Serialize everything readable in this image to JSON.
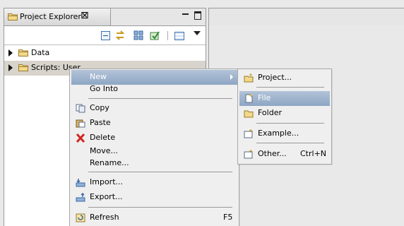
{
  "explorer": {
    "tab_title": "Project Explorer",
    "close_glyph": "⊠",
    "tree": [
      {
        "label": "Data",
        "icon": "folder-icon"
      },
      {
        "label": "Scripts: User",
        "icon": "folder-icon"
      }
    ]
  },
  "context_menu": {
    "items": {
      "new": {
        "label": "New"
      },
      "go_into": {
        "label": "Go Into"
      },
      "copy": {
        "label": "Copy",
        "icon": "copy-icon"
      },
      "paste": {
        "label": "Paste",
        "icon": "paste-icon"
      },
      "delete": {
        "label": "Delete",
        "icon": "delete-icon"
      },
      "move": {
        "label": "Move..."
      },
      "rename": {
        "label": "Rename..."
      },
      "import": {
        "label": "Import...",
        "icon": "import-icon"
      },
      "export": {
        "label": "Export...",
        "icon": "export-icon"
      },
      "refresh": {
        "label": "Refresh",
        "accelerator": "F5",
        "icon": "refresh-icon"
      }
    }
  },
  "submenu": {
    "items": {
      "project": {
        "label": "Project...",
        "icon": "new-project-icon"
      },
      "file": {
        "label": "File",
        "icon": "new-file-icon"
      },
      "folder": {
        "label": "Folder",
        "icon": "folder-icon"
      },
      "example": {
        "label": "Example...",
        "icon": "new-example-icon"
      },
      "other": {
        "label": "Other...",
        "accelerator": "Ctrl+N",
        "icon": "new-other-icon"
      }
    }
  },
  "colors": {
    "highlight": "#8ea6c4",
    "selection_row": "#d8d3cb",
    "menu_bg": "#efefef"
  }
}
